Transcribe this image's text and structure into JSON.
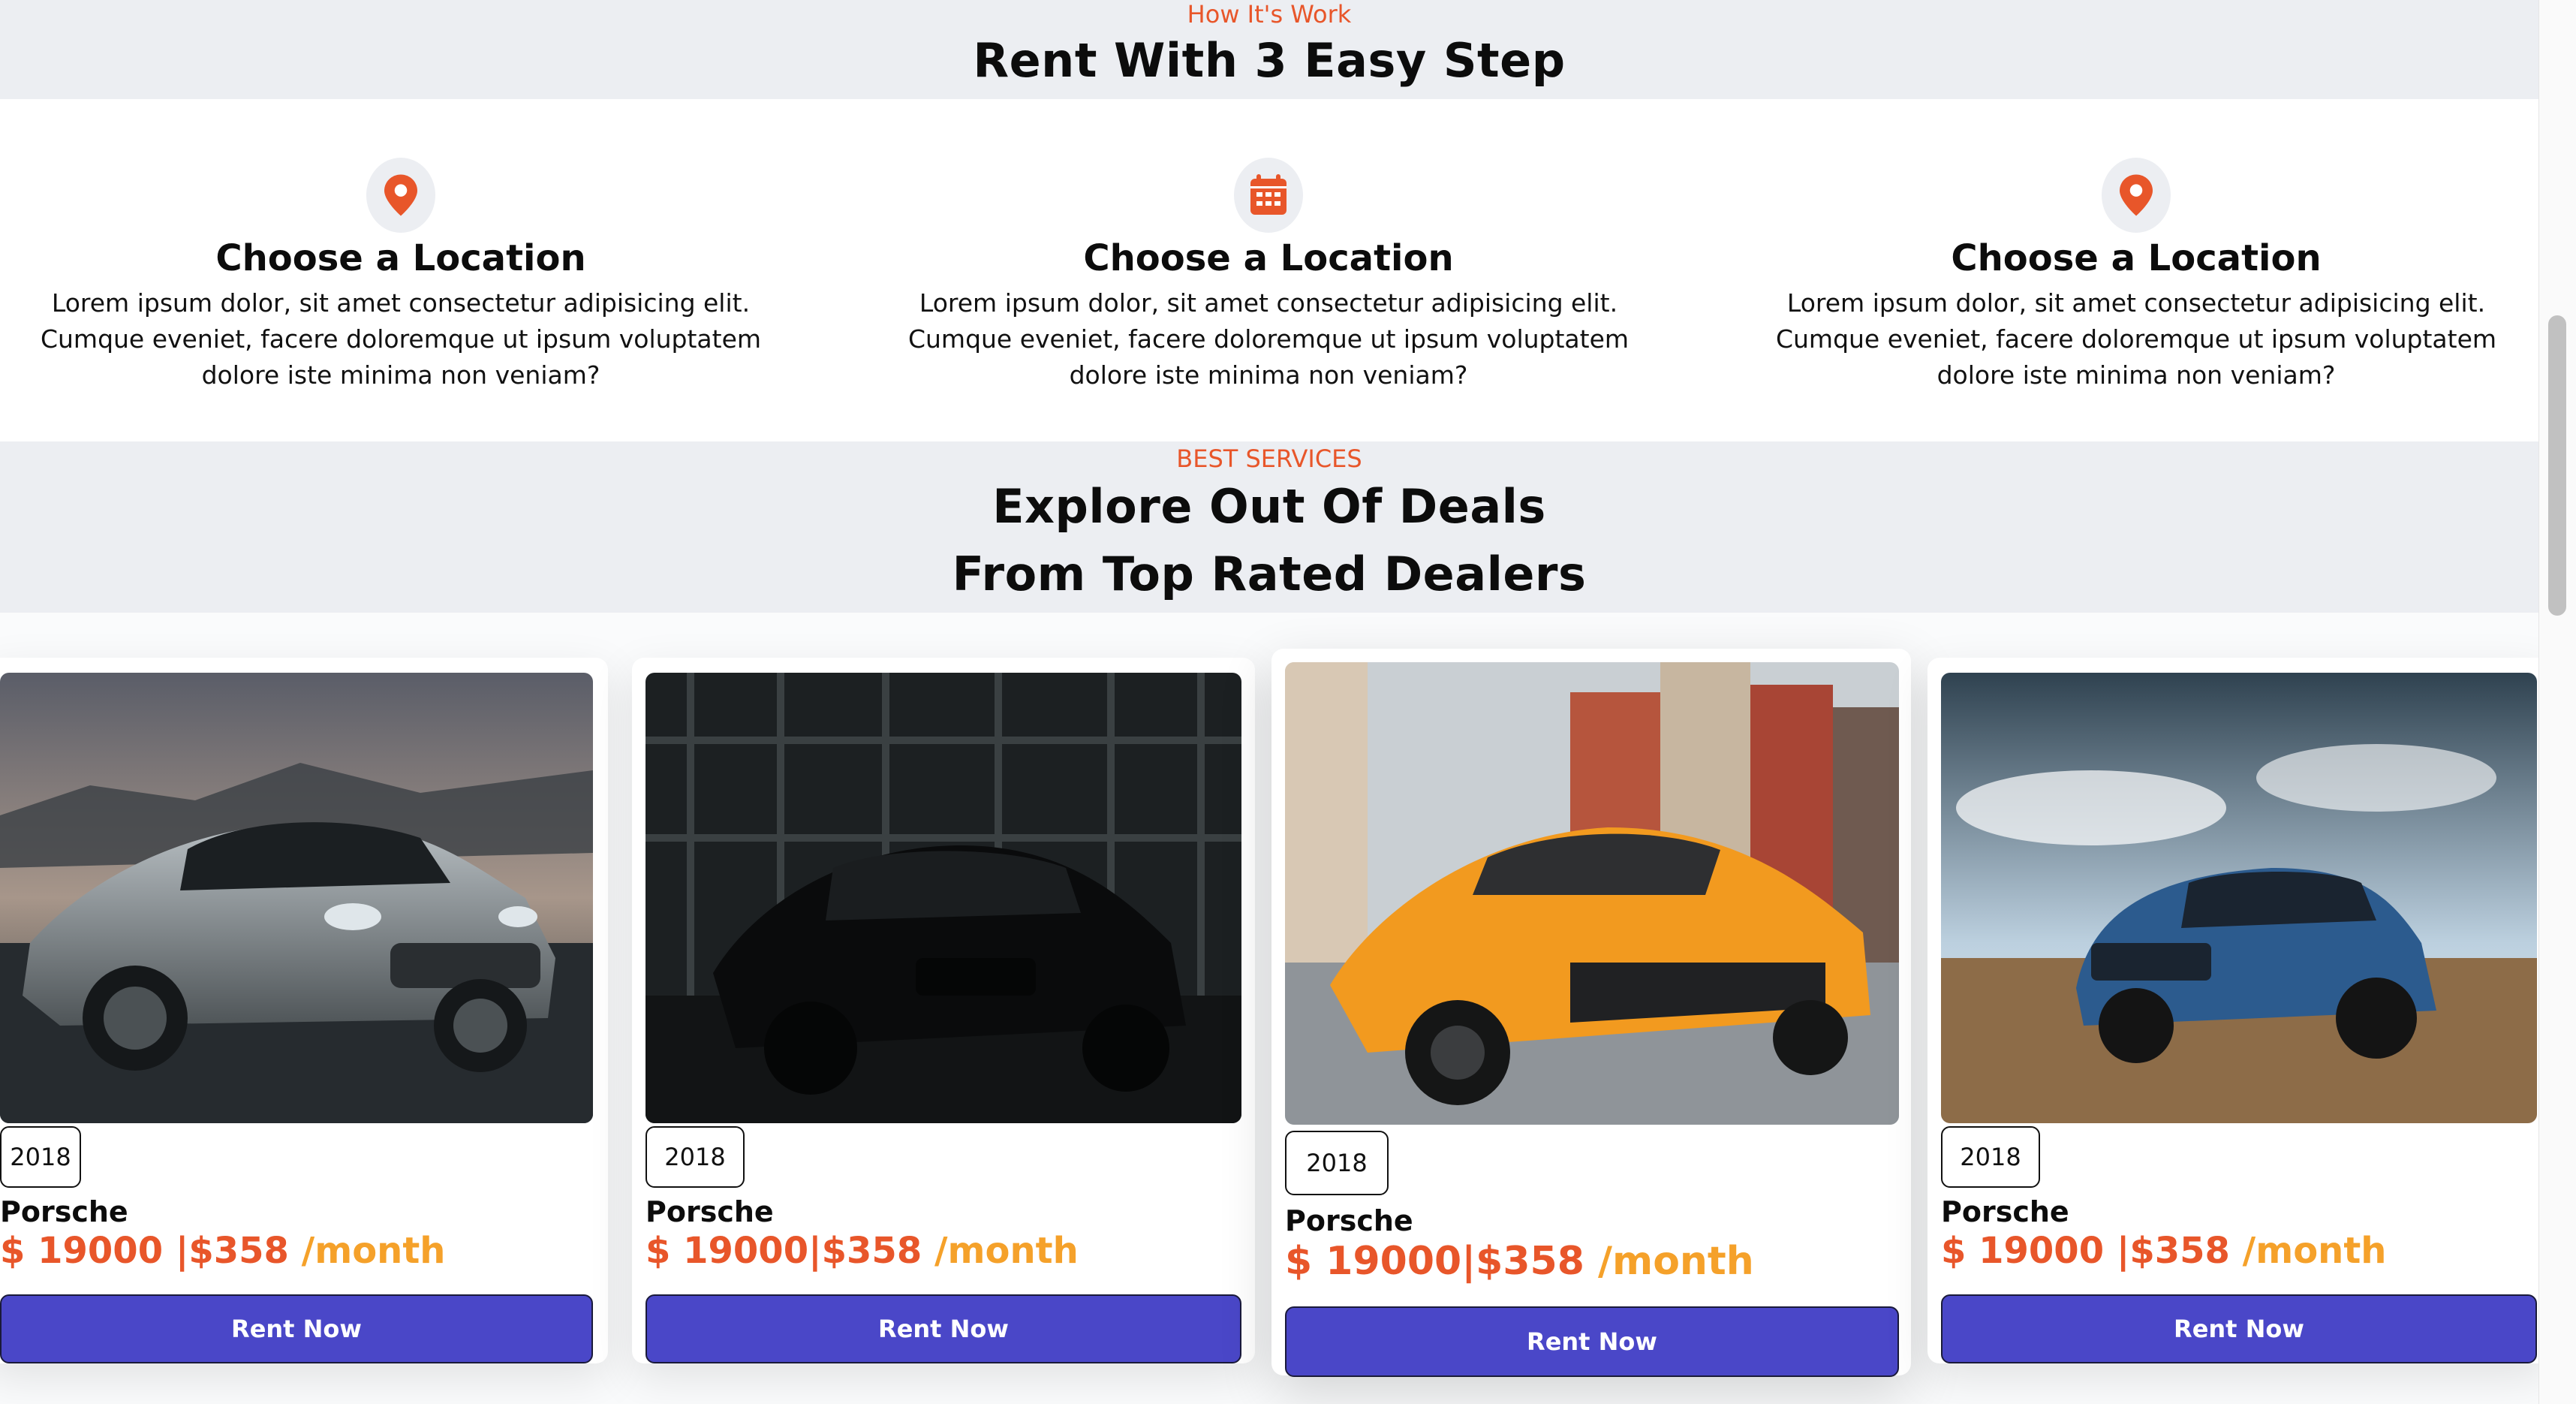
{
  "how_it_works": {
    "eyebrow": "How It's Work",
    "heading": "Rent With 3 Easy Step",
    "steps": [
      {
        "icon": "location-pin-icon",
        "title": "Choose a Location",
        "line1": "Lorem ipsum dolor, sit amet consectetur adipisicing elit.",
        "line2": "Cumque eveniet, facere doloremque ut ipsum voluptatem",
        "line3": "dolore iste minima non veniam?"
      },
      {
        "icon": "calendar-icon",
        "title": "Choose a Location",
        "line1": "Lorem ipsum dolor, sit amet consectetur adipisicing elit.",
        "line2": "Cumque eveniet, facere doloremque ut ipsum voluptatem",
        "line3": "dolore iste minima non veniam?"
      },
      {
        "icon": "location-pin-icon",
        "title": "Choose a Location",
        "line1": "Lorem ipsum dolor, sit amet consectetur adipisicing elit.",
        "line2": "Cumque eveniet, facere doloremque ut ipsum voluptatem",
        "line3": "dolore iste minima non veniam?"
      }
    ]
  },
  "deals": {
    "eyebrow": "BEST SERVICES",
    "heading_line1": "Explore Out Of Deals",
    "heading_line2": "From Top Rated Dealers",
    "cars": [
      {
        "image": "silver-bmw-coupe",
        "year": "2018",
        "model": "Porsche",
        "price": "$ 19000 |$358 ",
        "per": "/month",
        "button": "Rent Now"
      },
      {
        "image": "black-honda-civic",
        "year": "2018",
        "model": "Porsche",
        "price": "$ 19000|$358 ",
        "per": "/month",
        "button": "Rent Now"
      },
      {
        "image": "orange-porsche-cayman",
        "year": "2018",
        "model": "Porsche",
        "price": "$ 19000|$358 ",
        "per": "/month",
        "button": "Rent Now"
      },
      {
        "image": "blue-volvo-suv",
        "year": "2018",
        "model": "Porsche",
        "price": "$ 19000 |$358 ",
        "per": "/month",
        "button": "Rent Now"
      }
    ]
  },
  "colors": {
    "accent": "#e8562a",
    "per_month": "#f5a12a",
    "button": "#4a47c8",
    "band": "#eceef2"
  }
}
